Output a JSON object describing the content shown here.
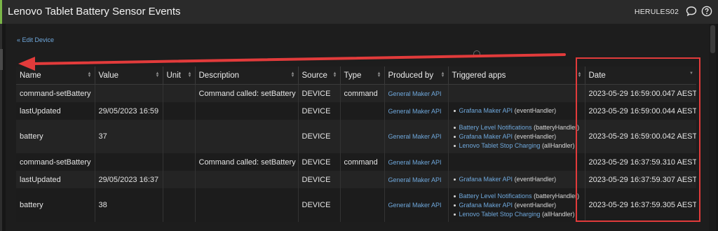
{
  "header": {
    "title": "Lenovo Tablet Battery Sensor Events",
    "user": "HERULES02"
  },
  "nav": {
    "edit_device": "« Edit Device"
  },
  "table": {
    "columns": [
      "Name",
      "Value",
      "Unit",
      "Description",
      "Source",
      "Type",
      "Produced by",
      "Triggered apps",
      "Date"
    ],
    "rows": [
      {
        "name": "command-setBattery",
        "value": "",
        "unit": "",
        "description": "Command called: setBattery",
        "source": "DEVICE",
        "type": "command",
        "produced_by": "General Maker API",
        "apps": [],
        "date": "2023-05-29 16:59:00.047 AEST"
      },
      {
        "name": "lastUpdated",
        "value": "29/05/2023 16:59",
        "unit": "",
        "description": "",
        "source": "DEVICE",
        "type": "",
        "produced_by": "General Maker API",
        "apps": [
          {
            "app": "Grafana Maker API",
            "handler": "(eventHandler)"
          }
        ],
        "date": "2023-05-29 16:59:00.044 AEST"
      },
      {
        "name": "battery",
        "value": "37",
        "unit": "",
        "description": "",
        "source": "DEVICE",
        "type": "",
        "produced_by": "General Maker API",
        "apps": [
          {
            "app": "Battery Level Notifications",
            "handler": "(batteryHandler)"
          },
          {
            "app": "Grafana Maker API",
            "handler": "(eventHandler)"
          },
          {
            "app": "Lenovo Tablet Stop Charging",
            "handler": "(allHandler)"
          }
        ],
        "date": "2023-05-29 16:59:00.042 AEST"
      },
      {
        "name": "command-setBattery",
        "value": "",
        "unit": "",
        "description": "Command called: setBattery",
        "source": "DEVICE",
        "type": "command",
        "produced_by": "General Maker API",
        "apps": [],
        "date": "2023-05-29 16:37:59.310 AEST"
      },
      {
        "name": "lastUpdated",
        "value": "29/05/2023 16:37",
        "unit": "",
        "description": "",
        "source": "DEVICE",
        "type": "",
        "produced_by": "General Maker API",
        "apps": [
          {
            "app": "Grafana Maker API",
            "handler": "(eventHandler)"
          }
        ],
        "date": "2023-05-29 16:37:59.307 AEST"
      },
      {
        "name": "battery",
        "value": "38",
        "unit": "",
        "description": "",
        "source": "DEVICE",
        "type": "",
        "produced_by": "General Maker API",
        "apps": [
          {
            "app": "Battery Level Notifications",
            "handler": "(batteryHandler)"
          },
          {
            "app": "Grafana Maker API",
            "handler": "(eventHandler)"
          },
          {
            "app": "Lenovo Tablet Stop Charging",
            "handler": "(allHandler)"
          }
        ],
        "date": "2023-05-29 16:37:59.305 AEST"
      }
    ]
  },
  "annotation": {
    "arrow_color": "#e23b3b",
    "box_color": "#e23b3b"
  },
  "colors": {
    "link": "#6fa8dc",
    "accent_bar": "#7ab648"
  }
}
